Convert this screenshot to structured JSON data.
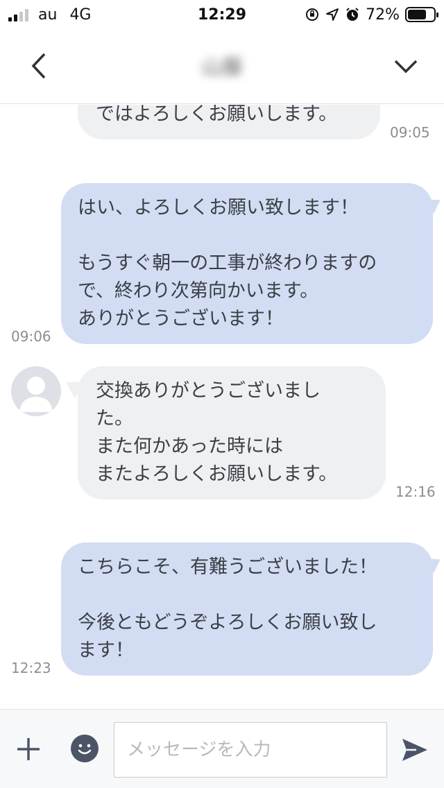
{
  "status_bar": {
    "carrier": "au",
    "network": "4G",
    "time": "12:29",
    "battery": "72%",
    "battery_level": 0.72
  },
  "header": {
    "title": "山藤"
  },
  "messages": [
    {
      "direction": "in",
      "text": "ではよろしくお願いします。",
      "time": "09:05"
    },
    {
      "direction": "out",
      "text": "はい、よろしくお願い致します！\n\nもうすぐ朝一の工事が終わりますの\nで、終わり次第向かいます。\nありがとうございます！",
      "time": "09:06"
    },
    {
      "direction": "in",
      "text": "交換ありがとうございまし\nた。\nまた何かあった時には\nまたよろしくお願いします。",
      "time": "12:16"
    },
    {
      "direction": "out",
      "text": "こちらこそ、有難うございました！\n\n今後ともどうぞよろしくお願い致し\nます！",
      "time": "12:23"
    }
  ],
  "input": {
    "placeholder": "メッセージを入力",
    "value": ""
  },
  "icons": {
    "back": "chevron-left-icon",
    "menu": "chevron-down-icon",
    "add": "plus-icon",
    "emoji": "smiley-icon",
    "send": "send-icon"
  },
  "colors": {
    "incoming_bubble": "#eff0f2",
    "outgoing_bubble": "#d2ddf4"
  }
}
